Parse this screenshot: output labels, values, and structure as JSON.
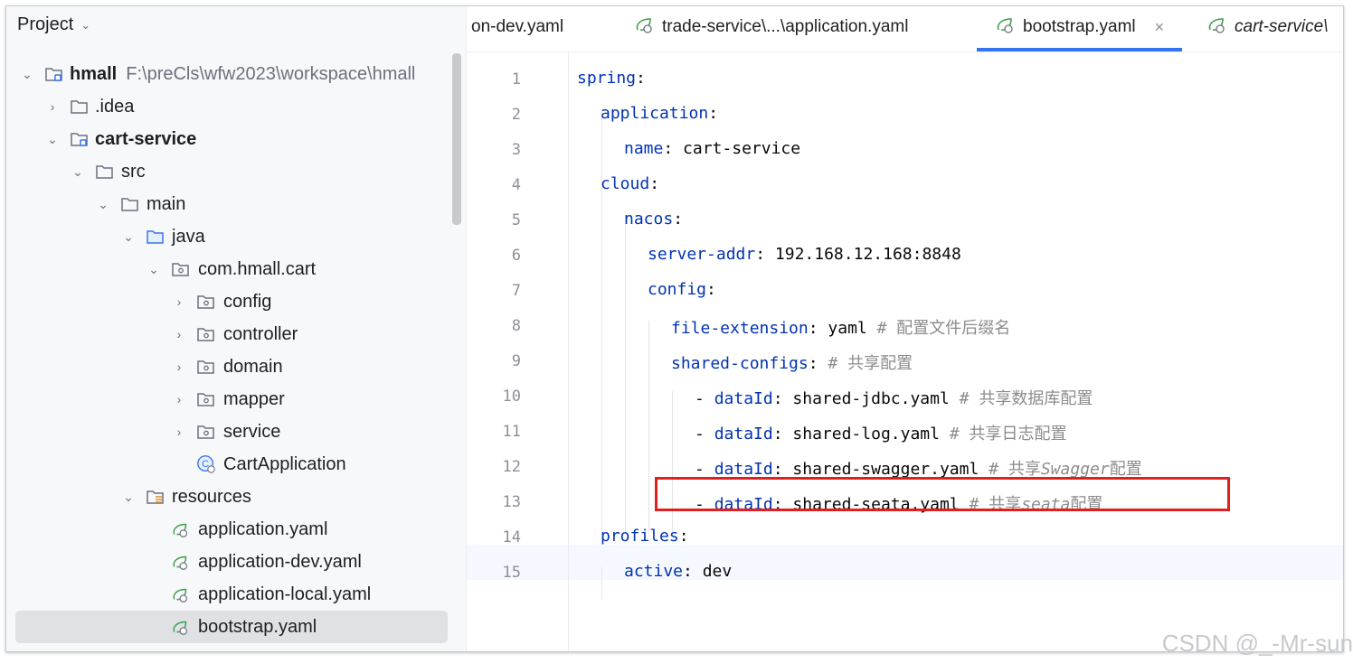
{
  "panel": {
    "title": "Project"
  },
  "tree": {
    "root": {
      "name": "hmall",
      "path": "F:\\preCls\\wfw2023\\workspace\\hmall"
    },
    "idea": ".idea",
    "module": "cart-service",
    "src": "src",
    "main": "main",
    "java": "java",
    "pkg": "com.hmall.cart",
    "config": "config",
    "controller": "controller",
    "domain": "domain",
    "mapper": "mapper",
    "service": "service",
    "app_class": "CartApplication",
    "resources": "resources",
    "file1": "application.yaml",
    "file2": "application-dev.yaml",
    "file3": "application-local.yaml",
    "file4": "bootstrap.yaml"
  },
  "tabs": {
    "t1": "on-dev.yaml",
    "t2": "trade-service\\...\\application.yaml",
    "t3": "bootstrap.yaml",
    "t4": "cart-service\\"
  },
  "code": {
    "lines": [
      "1",
      "2",
      "3",
      "4",
      "5",
      "6",
      "7",
      "8",
      "9",
      "10",
      "11",
      "12",
      "13",
      "14",
      "15"
    ],
    "spring": "spring",
    "application": "application",
    "name_key": "name",
    "name_val": "cart-service",
    "cloud": "cloud",
    "nacos": "nacos",
    "server_addr": "server-addr",
    "server_val": "192.168.12.168:8848",
    "config": "config",
    "file_ext": "file-extension",
    "file_ext_val": "yaml",
    "cmt_file_ext": "# 配置文件后缀名",
    "shared_configs": "shared-configs",
    "cmt_shared": "# 共享配置",
    "dataId": "dataId",
    "d1": "shared-jdbc.yaml",
    "c1": "# 共享数据库配置",
    "d2": "shared-log.yaml",
    "c2": "# 共享日志配置",
    "d3": "shared-swagger.yaml",
    "c3a": "# 共享",
    "c3b": "Swagger",
    "c3c": "配置",
    "d4": "shared-seata.yaml",
    "c4a": "# 共享",
    "c4b": "seata",
    "c4c": "配置",
    "profiles": "profiles",
    "active": "active",
    "active_val": "dev"
  },
  "watermark": "CSDN @_-Mr-sun",
  "colors": {
    "accent": "#3574f0",
    "key": "#0033b3",
    "comment": "#8c8c8c",
    "highlight_box": "#e02020"
  }
}
